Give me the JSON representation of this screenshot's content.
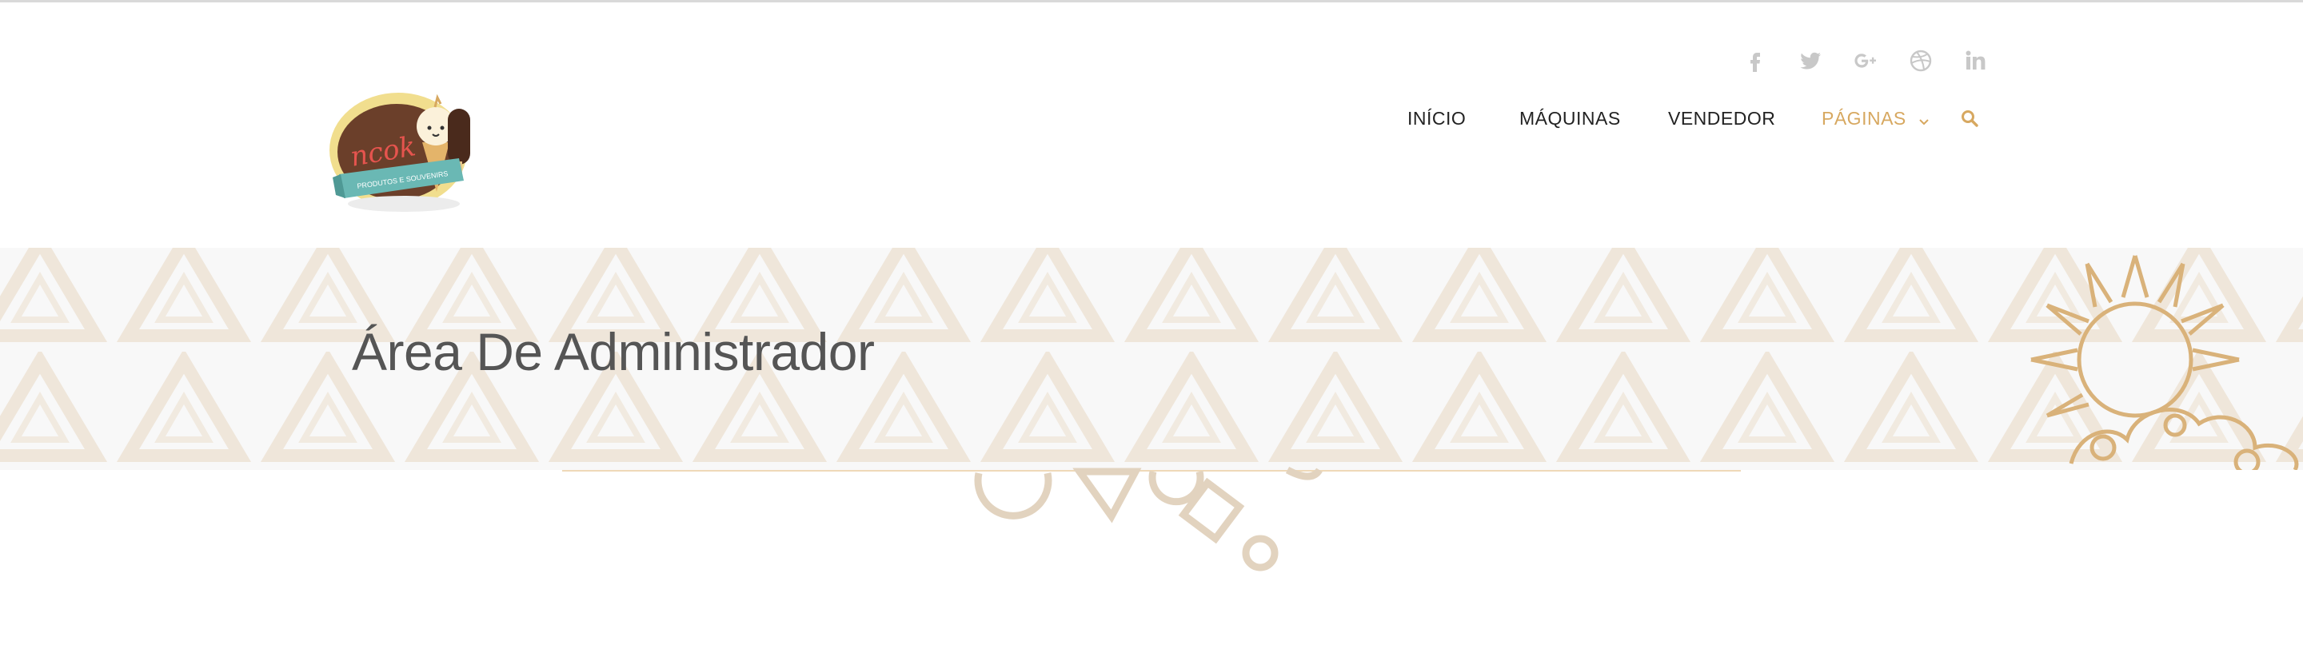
{
  "nav": {
    "items": [
      {
        "label": "INÍCIO",
        "active": false
      },
      {
        "label": "MÁQUINAS",
        "active": false
      },
      {
        "label": "VENDEDOR",
        "active": false
      },
      {
        "label": "PÁGINAS",
        "active": true,
        "has_dropdown": true
      }
    ],
    "search_icon": "search-icon"
  },
  "social": [
    "facebook-icon",
    "twitter-icon",
    "google-plus-icon",
    "dribbble-icon",
    "linkedin-icon"
  ],
  "logo": {
    "text": "ncok",
    "ribbon_text": "PRODUTOS E SOUVENIRS"
  },
  "banner": {
    "title": "Área De Administrador"
  },
  "colors": {
    "accent": "#d7a860",
    "nav_text": "#222222",
    "social_icon": "#c8c8c8",
    "banner_bg": "#f8f8f8",
    "title_text": "#555555",
    "logo_ribbon": "#6ab8b4",
    "logo_chocolate": "#6b3f2a"
  }
}
